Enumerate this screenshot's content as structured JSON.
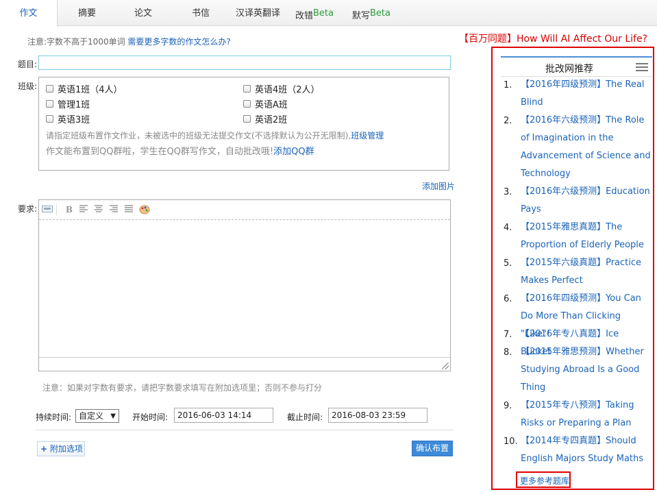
{
  "tabs": [
    {
      "label": "作文",
      "beta": ""
    },
    {
      "label": "摘要",
      "beta": ""
    },
    {
      "label": "论文",
      "beta": ""
    },
    {
      "label": "书信",
      "beta": ""
    },
    {
      "label": "汉译英翻译",
      "beta": ""
    },
    {
      "label": "改错",
      "beta": "Beta"
    },
    {
      "label": "默写",
      "beta": "Beta"
    }
  ],
  "notice": {
    "text": "注意:字数不高于1000单词",
    "link": "需要更多字数的作文怎么办?"
  },
  "promo": {
    "bracket": "【百万同题】",
    "text": "How Will AI Affect Our Life?"
  },
  "form": {
    "title_label": "题目:",
    "title_value": "",
    "class_label": "班级:",
    "classes": [
      "英语1班（4人）",
      "英语4班（2人）",
      "管理1班",
      "英语A班",
      "英语3班",
      "英语2班"
    ],
    "class_hint": "请指定班级布置作文作业，未被选中的班级无法提交作文(不选择默认为公开无限制),",
    "class_manage_link": "班级管理",
    "qq_hint": "作文能布置到QQ群啦，学生在QQ群写作文，自动批改哦!",
    "qq_link": "添加QQ群",
    "add_image": "添加图片",
    "req_label": "要求:",
    "note": "注意：如果对字数有要求，请把字数要求填写在附加选项里；否则不参与打分",
    "duration_label": "持续时间:",
    "duration_value": "自定义",
    "start_label": "开始时间:",
    "start_value": "2016-06-03 14:14",
    "end_label": "截止时间:",
    "end_value": "2016-08-03 23:59",
    "extra_button": "附加选项",
    "extra_plus": "+",
    "confirm_button": "确认布置"
  },
  "editor_toolbar": {
    "bold": "B"
  },
  "recommend": {
    "title": "批改网推荐",
    "items": [
      {
        "num": "1.",
        "tag": "【2016年四级预测】",
        "text": "The Real Blind"
      },
      {
        "num": "2.",
        "tag": "【2016年六级预测】",
        "text": "The Role of Imagination in the Advancement of Science and Technology"
      },
      {
        "num": "3.",
        "tag": "【2016年六级预测】",
        "text": "Education Pays"
      },
      {
        "num": "4.",
        "tag": "【2015年雅思真题】",
        "text": "The Proportion of Elderly People"
      },
      {
        "num": "5.",
        "tag": "【2015年六级真题】",
        "text": "Practice Makes Perfect"
      },
      {
        "num": "6.",
        "tag": "【2016年四级预测】",
        "text": "You Can Do More Than Clicking \"Like\"!"
      },
      {
        "num": "7.",
        "tag": "【2016年专八真题】",
        "text": "Ice Bucket"
      },
      {
        "num": "8.",
        "tag": "【2015年雅思预测】",
        "text": "Whether Studying Abroad Is a Good Thing"
      },
      {
        "num": "9.",
        "tag": "【2015年专八预测】",
        "text": "Taking Risks or Preparing a Plan"
      },
      {
        "num": "10.",
        "tag": "【2014年专四真题】",
        "text": "Should English Majors Study Maths"
      }
    ],
    "more": "更多参考题库"
  }
}
